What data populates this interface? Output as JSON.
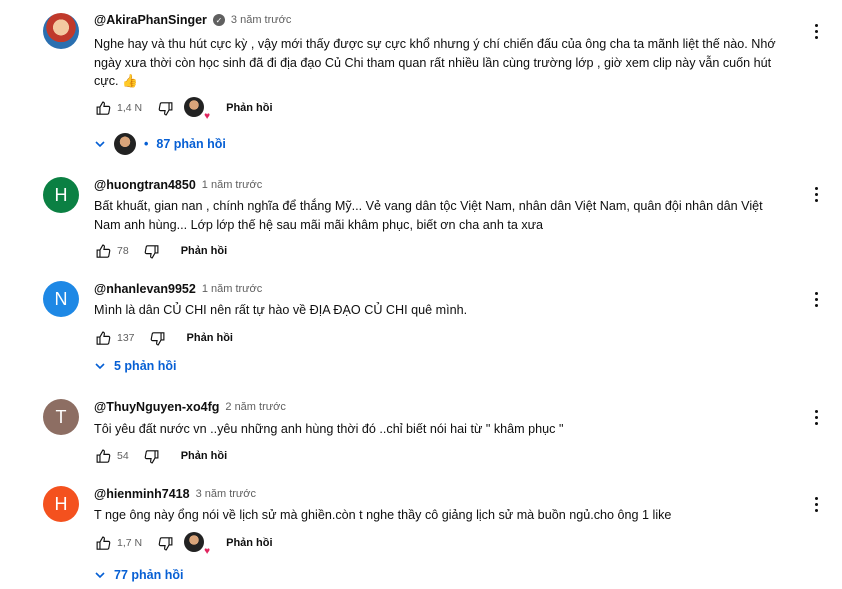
{
  "comments": [
    {
      "author": "@AkiraPhanSinger",
      "verified": true,
      "time": "3 năm trước",
      "avatar_type": "photo",
      "text": "Nghe hay và thu hút cực kỳ , vậy mới thấy được sự cực khổ nhưng ý chí chiến đấu của ông cha ta mãnh liệt thế nào. Nhớ ngày xưa thời còn học sinh đã đi địa đạo Củ Chi tham quan rất nhiều lần cùng trường lớp , giờ xem clip này vẫn cuốn hút cực. 👍",
      "likes": "1,4 N",
      "creator_heart": true,
      "reply_label": "Phản hồi",
      "replies_label": "87 phản hồi"
    },
    {
      "author": "@huongtran4850",
      "time": "1 năm trước",
      "avatar_letter": "H",
      "avatar_color": "#0b8043",
      "text": "Bất khuất, gian nan , chính nghĩa để thắng Mỹ... Vẻ vang dân tộc Việt Nam, nhân dân Việt Nam, quân đội nhân dân Việt Nam anh hùng... Lớp lớp thế hệ sau mãi mãi khâm phục, biết ơn cha anh ta xưa",
      "likes": "78",
      "reply_label": "Phản hồi"
    },
    {
      "author": "@nhanlevan9952",
      "time": "1 năm trước",
      "avatar_letter": "N",
      "avatar_color": "#1e88e5",
      "text": "Mình là dân CỦ CHI nên rất tự hào về ĐỊA ĐẠO CỦ CHI quê mình.",
      "likes": "137",
      "reply_label": "Phản hồi",
      "replies_label": "5 phản hồi"
    },
    {
      "author": "@ThuyNguyen-xo4fg",
      "time": "2 năm trước",
      "avatar_letter": "T",
      "avatar_color": "#8d6e63",
      "text": "Tôi yêu đất nước vn ..yêu những anh hùng thời đó ..chỉ biết nói hai từ \" khâm phục \"",
      "likes": "54",
      "reply_label": "Phản hồi"
    },
    {
      "author": "@hienminh7418",
      "time": "3 năm trước",
      "avatar_letter": "H",
      "avatar_color": "#f4511e",
      "text": "T nge ông này ổng nói về lịch sử mà ghiền.còn t nghe thầy cô giảng lịch sử mà buồn ngủ.cho ông 1 like",
      "likes": "1,7 N",
      "creator_heart": true,
      "reply_label": "Phản hồi",
      "replies_label": "77 phản hồi"
    }
  ],
  "colors": {
    "link_blue": "#065fd4",
    "meta_gray": "#606060",
    "heart_red": "#e0245e"
  },
  "icons": {
    "like": "thumbs-up-icon",
    "dislike": "thumbs-down-icon",
    "more": "kebab-menu-icon",
    "expand": "chevron-down-icon",
    "verified": "check-badge-icon"
  }
}
